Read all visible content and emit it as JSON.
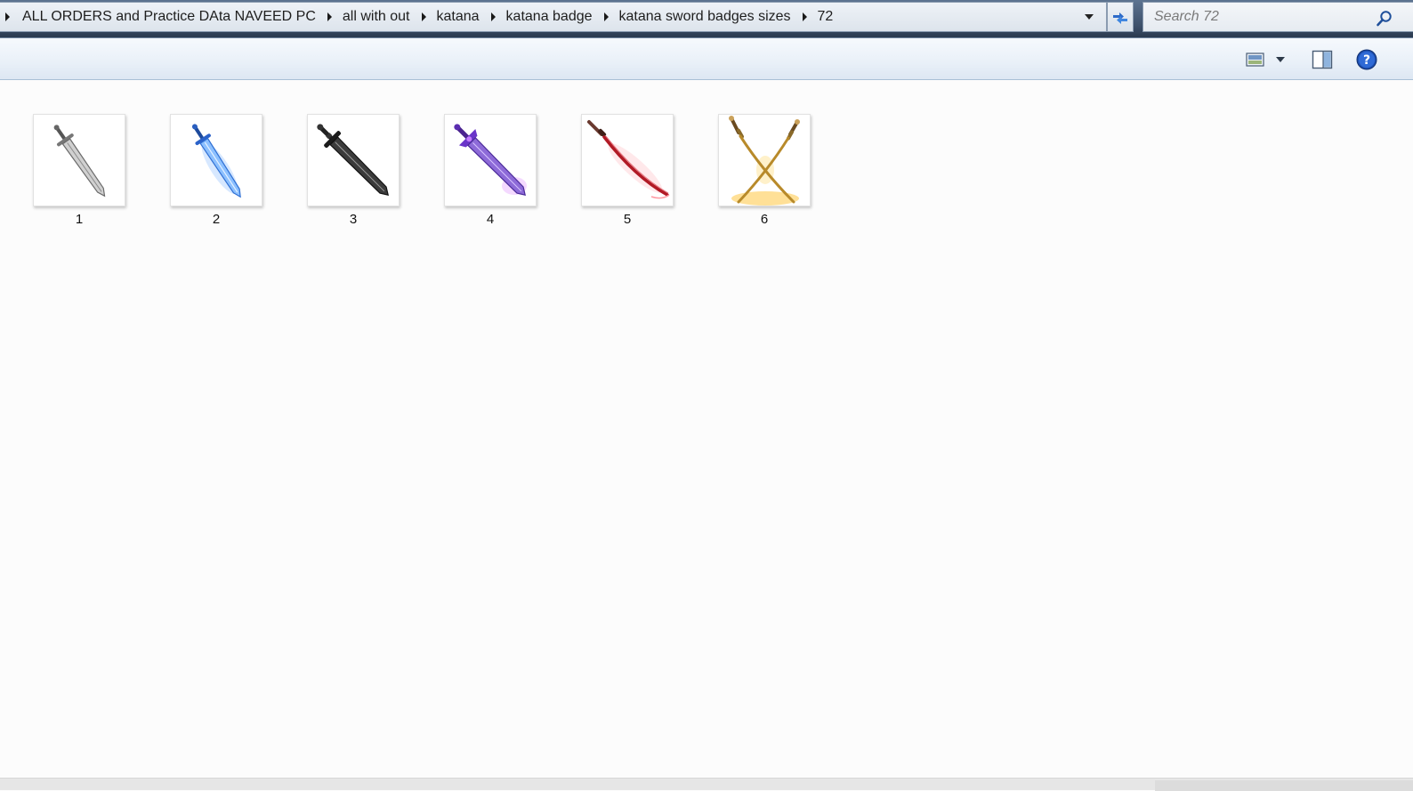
{
  "address_bar": {
    "breadcrumbs": [
      "ALL ORDERS and Practice DAta NAVEED PC",
      "all with out",
      "katana",
      "katana badge",
      "katana sword badges sizes",
      "72"
    ]
  },
  "search": {
    "placeholder": "Search 72"
  },
  "toolbar": {
    "icons": [
      "change-view-icon",
      "view-options-dropdown-icon",
      "preview-pane-icon",
      "help-icon"
    ]
  },
  "files": [
    {
      "label": "1",
      "icon": "silver-sword-thumbnail",
      "color": "#9a9a9a"
    },
    {
      "label": "2",
      "icon": "blue-sword-thumbnail",
      "color": "#3a7bd5"
    },
    {
      "label": "3",
      "icon": "black-sword-thumbnail",
      "color": "#2a2a2a"
    },
    {
      "label": "4",
      "icon": "purple-sword-thumbnail",
      "color": "#6a3cc0"
    },
    {
      "label": "5",
      "icon": "red-katana-thumbnail",
      "color": "#b0202a"
    },
    {
      "label": "6",
      "icon": "golden-crossed-swords-thumbnail",
      "color": "#c8922a"
    }
  ],
  "colors": {
    "address_frame": "#3d506a",
    "command_bar": "#e9f0f8",
    "content_bg": "#fcfcfc"
  }
}
